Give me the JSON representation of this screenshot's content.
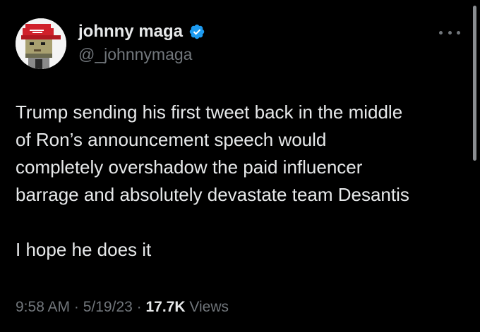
{
  "author": {
    "display_name": "johnny maga",
    "handle": "@_johnnymaga",
    "verified": true,
    "avatar_icon": "pixel-art-avatar-red-hat-icon",
    "badge_color": "#1d9bf0"
  },
  "tweet": {
    "paragraphs": [
      "Trump sending his first tweet back in the middle\nof Ron’s announcement speech would\ncompletely overshadow the paid influencer\nbarrage and absolutely devastate team Desantis",
      "I hope he does it"
    ]
  },
  "meta": {
    "time": "9:58 AM",
    "separator": " · ",
    "date": "5/19/23",
    "views_count": "17.7K",
    "views_label": " Views"
  },
  "colors": {
    "background": "#000000",
    "primary_text": "#e7e9ea",
    "secondary_text": "#71767b",
    "accent": "#1d9bf0"
  },
  "icons": {
    "more": "more-horizontal-icon",
    "verified": "verified-badge-icon"
  }
}
